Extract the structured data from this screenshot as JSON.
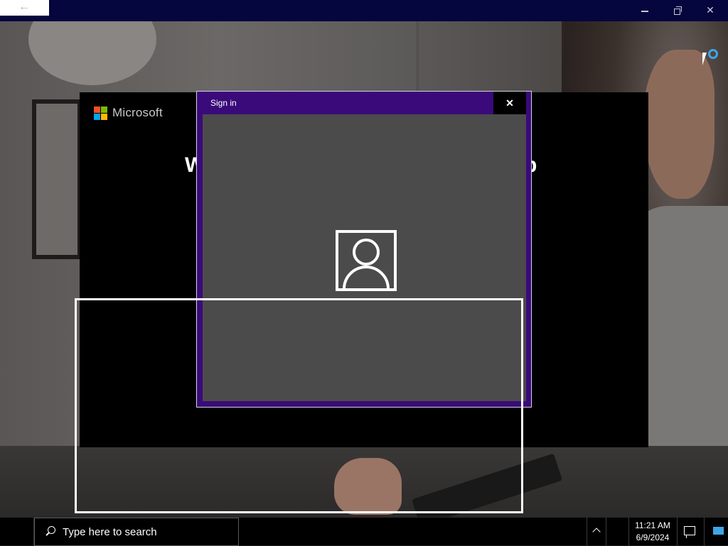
{
  "titlebar": {
    "back_glyph": "←",
    "close_glyph": "✕"
  },
  "oobe": {
    "brand": "Microsoft",
    "heading_left_fragment": "W",
    "heading_right_fragment": "p"
  },
  "signin_dialog": {
    "title": "Sign in",
    "close_glyph": "✕",
    "icon": "user-account-icon"
  },
  "taskbar": {
    "search_placeholder": "Type here to search",
    "time": "11:21 AM",
    "date": "6/9/2024"
  },
  "colors": {
    "titlebar_bg": "#05063d",
    "dialog_border_purple": "#3a0a7a",
    "dialog_body": "#4b4b4b",
    "accent_blue": "#3ea6e6"
  }
}
